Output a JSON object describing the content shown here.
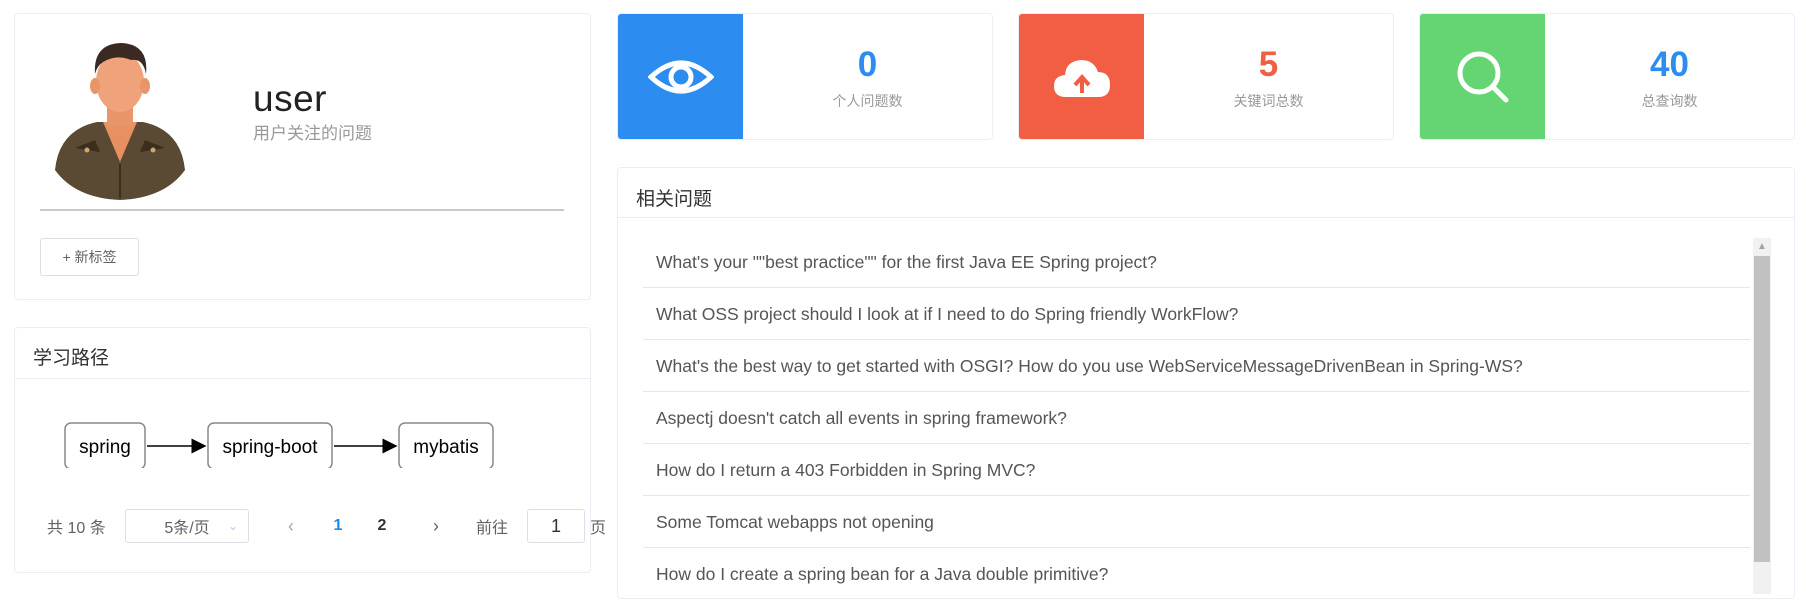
{
  "profile": {
    "username": "user",
    "subtitle": "用户关注的问题",
    "new_tag_button": "+ 新标签"
  },
  "learning_path": {
    "title": "学习路径",
    "nodes": [
      "spring",
      "spring-boot",
      "mybatis"
    ],
    "pagination": {
      "total_text": "共 10 条",
      "page_size": "5条/页",
      "pages": [
        "1",
        "2"
      ],
      "current_page": "1",
      "goto_label": "前往",
      "goto_value": "1",
      "goto_suffix": "页"
    }
  },
  "stats": [
    {
      "value": "0",
      "label": "个人问题数",
      "color": "#2d8cf0",
      "number_color": "#2d8cf0",
      "icon": "eye-icon"
    },
    {
      "value": "5",
      "label": "关键词总数",
      "color": "#f25e43",
      "number_color": "#f25e43",
      "icon": "cloud-upload-icon"
    },
    {
      "value": "40",
      "label": "总查询数",
      "color": "#64d572",
      "number_color": "#2d8cf0",
      "icon": "search-icon"
    }
  ],
  "related": {
    "title": "相关问题",
    "questions": [
      "What's your \"\"best practice\"\" for the first Java EE Spring project?",
      "What OSS project should I look at if I need to do Spring friendly WorkFlow?",
      "What's the best way to get started with OSGI? How do you use WebServiceMessageDrivenBean in Spring-WS?",
      "Aspectj doesn't catch all events in spring framework?",
      "How do I return a 403 Forbidden in Spring MVC?",
      "Some Tomcat webapps not opening",
      "How do I create a spring bean for a Java double primitive?"
    ]
  }
}
